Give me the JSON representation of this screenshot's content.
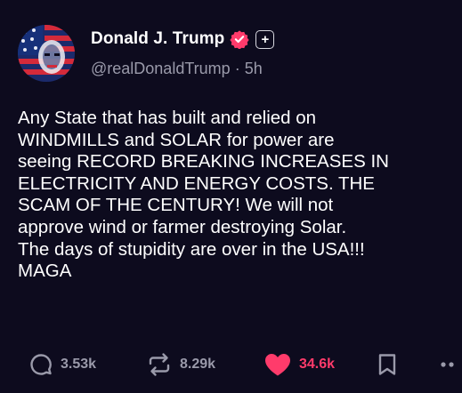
{
  "post": {
    "author": {
      "display_name": "Donald J. Trump",
      "handle": "@realDonaldTrump",
      "separator": "·",
      "time_ago": "5h",
      "verified_color": "#ff3b6b",
      "follow_button_glyph": "+"
    },
    "body": "Any State that has built and relied on\nWINDMILLS and SOLAR for power are\nseeing RECORD BREAKING INCREASES IN\nELECTRICITY AND ENERGY COSTS. THE\nSCAM OF THE CENTURY! We will not\napprove wind or farmer destroying Solar.\nThe days of stupidity are over in the USA!!!\nMAGA",
    "actions": {
      "replies": {
        "icon": "comment-icon",
        "count": "3.53k"
      },
      "reposts": {
        "icon": "repost-icon",
        "count": "8.29k"
      },
      "likes": {
        "icon": "heart-icon",
        "count": "34.6k",
        "liked": true,
        "color": "#ff3b6b"
      },
      "bookmark": {
        "icon": "bookmark-icon"
      },
      "more": {
        "icon": "more-icon"
      }
    }
  },
  "theme": {
    "background": "#0d0b1e",
    "text": "#ffffff",
    "muted": "#9a9aaa",
    "accent": "#ff3b6b"
  }
}
